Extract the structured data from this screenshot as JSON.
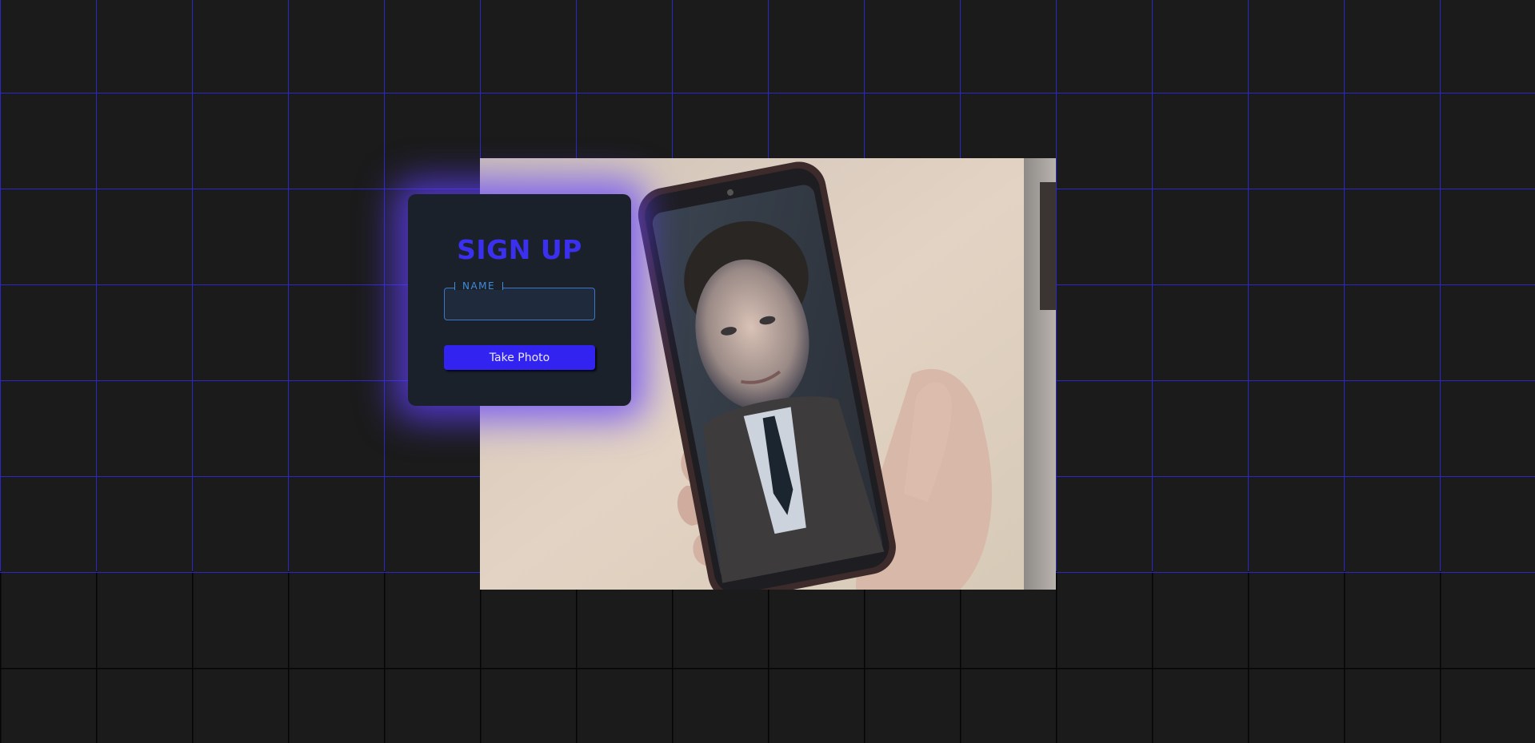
{
  "signup": {
    "title": "SIGN UP",
    "name_field": {
      "label": "NAME",
      "value": "",
      "placeholder": ""
    },
    "take_photo_label": "Take Photo"
  },
  "camera": {
    "icon": "webcam-feed"
  },
  "colors": {
    "background": "#1b1b1b",
    "grid_line": "#2b27c9",
    "accent": "#3223f0",
    "card": "#1b212b",
    "glow": "#6240ff",
    "field_border": "#3b76c9"
  }
}
